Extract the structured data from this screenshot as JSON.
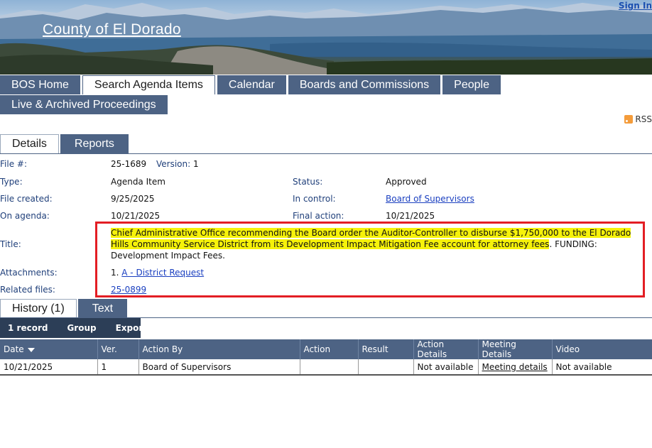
{
  "header": {
    "county_title": "County of El Dorado",
    "sign_in": "Sign In"
  },
  "nav": {
    "row1": [
      "BOS Home",
      "Search Agenda Items",
      "Calendar",
      "Boards and Commissions",
      "People"
    ],
    "row2": [
      "Live & Archived Proceedings"
    ],
    "active": "Search Agenda Items"
  },
  "rss": {
    "label": "RSS",
    "icon": "rss-icon"
  },
  "detail_tabs": {
    "details": "Details",
    "reports": "Reports"
  },
  "details": {
    "file_label": "File #:",
    "file_value": "25-1689",
    "version_label": "Version:",
    "version_value": "1",
    "type_label": "Type:",
    "type_value": "Agenda Item",
    "status_label": "Status:",
    "status_value": "Approved",
    "created_label": "File created:",
    "created_value": "9/25/2025",
    "control_label": "In control:",
    "control_value": "Board of Supervisors",
    "agenda_label": "On agenda:",
    "agenda_value": "10/21/2025",
    "final_label": "Final action:",
    "final_value": "10/21/2025",
    "title_label": "Title:",
    "title_highlighted": "Chief Administrative Office recommending the Board order the Auditor-Controller to disburse $1,750,000 to the El Dorado Hills Community Service District from its Development Impact Mitigation Fee account for attorney fees",
    "title_rest": ". FUNDING: Development Impact Fees.",
    "attachments_label": "Attachments:",
    "attachment_number": "1.",
    "attachment_link": "A - District Request",
    "related_label": "Related files:",
    "related_link": "25-0899"
  },
  "history_tabs": {
    "history": "History (1)",
    "text": "Text"
  },
  "toolbar": {
    "records": "1 record",
    "group": "Group",
    "export": "Export"
  },
  "grid": {
    "columns": [
      "Date",
      "Ver.",
      "Action By",
      "Action",
      "Result",
      "Action Details",
      "Meeting Details",
      "Video"
    ],
    "rows": [
      [
        "10/21/2025",
        "1",
        "Board of Supervisors",
        "",
        "",
        "Not available",
        "Meeting details",
        "Not available"
      ]
    ]
  }
}
